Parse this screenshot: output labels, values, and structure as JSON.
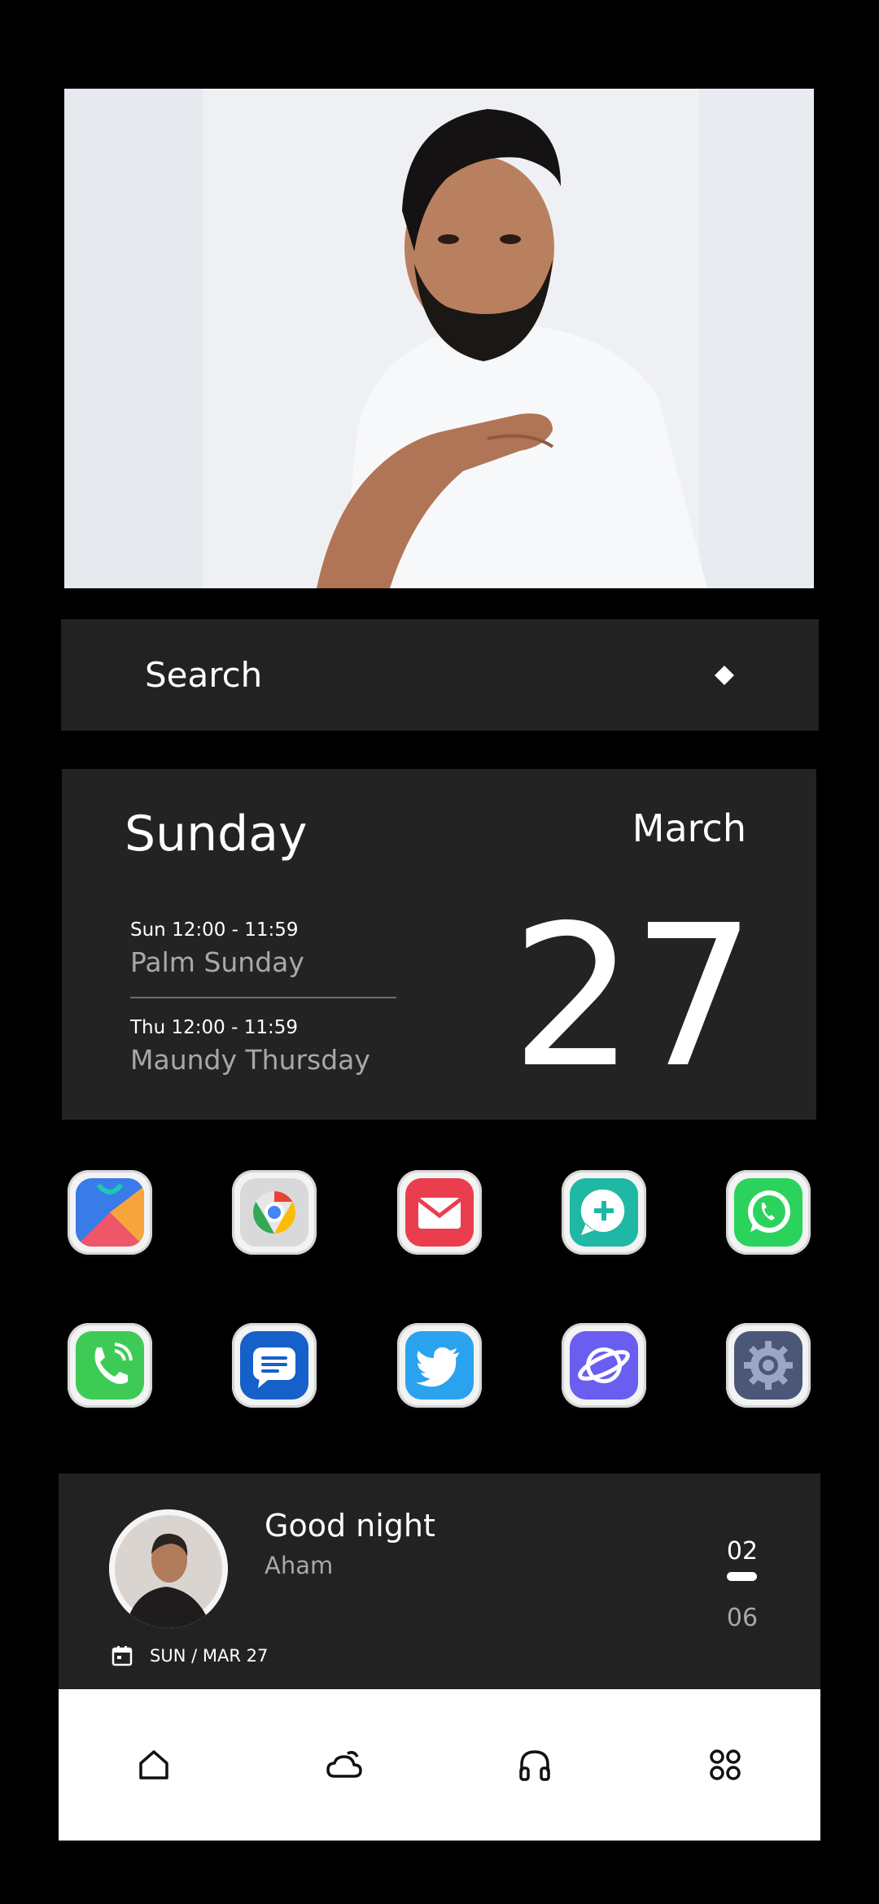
{
  "photo_widget": {
    "subject": "photo"
  },
  "search": {
    "label": "Search",
    "icon": "diamond-icon"
  },
  "calendar": {
    "day_name": "Sunday",
    "month": "March",
    "date": "27",
    "events": [
      {
        "time": "Sun 12:00 - 11:59",
        "title": "Palm Sunday"
      },
      {
        "time": "Thu 12:00 - 11:59",
        "title": "Maundy Thursday"
      }
    ]
  },
  "apps": [
    {
      "name": "Play Store",
      "icon": "play-store-icon"
    },
    {
      "name": "Chrome",
      "icon": "chrome-icon"
    },
    {
      "name": "Gmail",
      "icon": "mail-icon"
    },
    {
      "name": "Chat Plus",
      "icon": "chat-plus-icon"
    },
    {
      "name": "WhatsApp",
      "icon": "whatsapp-icon"
    },
    {
      "name": "Phone",
      "icon": "phone-icon"
    },
    {
      "name": "Messages",
      "icon": "messages-icon"
    },
    {
      "name": "Twitter",
      "icon": "twitter-icon"
    },
    {
      "name": "Internet",
      "icon": "browser-planet-icon"
    },
    {
      "name": "Settings",
      "icon": "settings-gear-icon"
    }
  ],
  "music": {
    "title": "Good night",
    "artist": "Aham",
    "track_current": "02",
    "track_total": "06",
    "date": "SUN / MAR 27"
  },
  "bottom_nav": [
    {
      "icon": "home-icon"
    },
    {
      "icon": "weather-icon"
    },
    {
      "icon": "headphones-icon"
    },
    {
      "icon": "apps-grid-icon"
    }
  ],
  "colors": {
    "background": "#000000",
    "widget": "#222222",
    "text_primary": "#ffffff",
    "text_secondary": "#a8a8a8",
    "nav_bg": "#ffffff"
  }
}
